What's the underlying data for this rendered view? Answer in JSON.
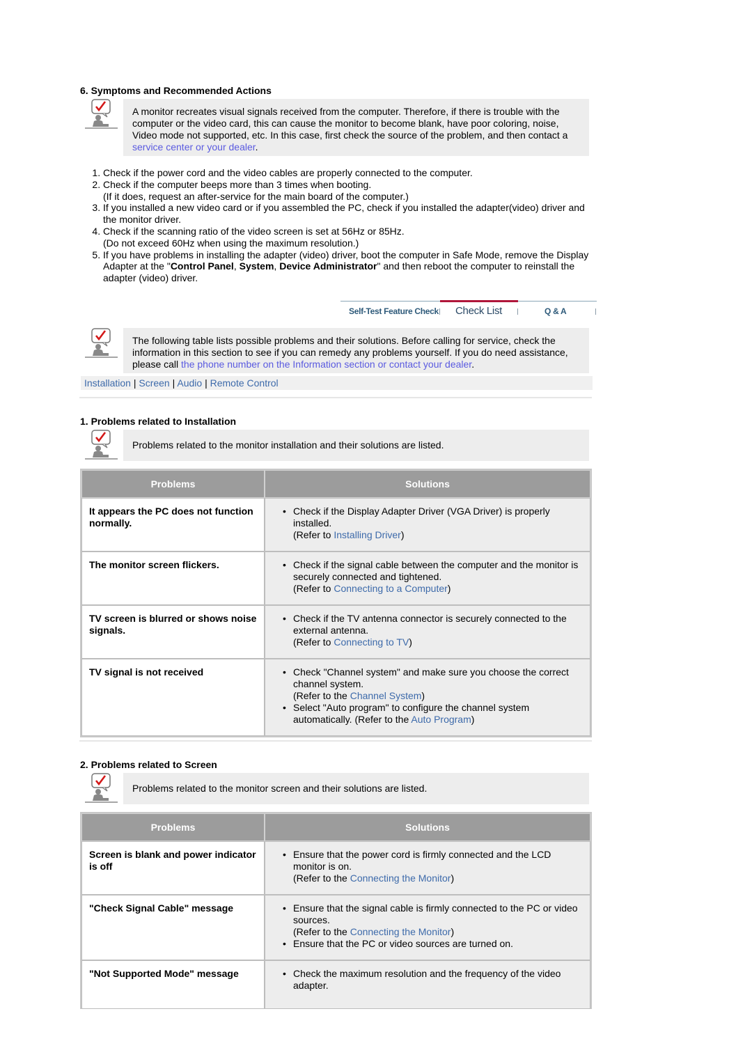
{
  "section6": {
    "title": "6. Symptoms and Recommended Actions",
    "intro_text": "A monitor recreates visual signals received from the computer. Therefore, if there is trouble with the computer or the video card, this can cause the monitor to become blank, have poor coloring, noise, Video mode not supported, etc. In this case, first check the source of the problem, and then contact a ",
    "intro_link": "service center or your dealer",
    "intro_end": ".",
    "steps": [
      {
        "text": "Check if the power cord and the video cables are properly connected to the computer."
      },
      {
        "text": "Check if the computer beeps more than 3 times when booting.",
        "sub": "(If it does, request an after-service for the main board of the computer.)"
      },
      {
        "text": "If you installed a new video card or if you assembled the PC, check if you installed the adapter(video) driver and the monitor driver."
      },
      {
        "text": "Check if the scanning ratio of the video screen is set at 56Hz or 85Hz.",
        "sub": "(Do not exceed 60Hz when using the maximum resolution.)"
      },
      {
        "pre": "If you have problems in installing the adapter (video) driver, boot the computer in Safe Mode, remove the Display Adapter at the \"",
        "b1": "Control Panel",
        "c1": ", ",
        "b2": "System",
        "c2": ", ",
        "b3": "Device Administrator",
        "post": "\" and then reboot the computer to reinstall the adapter (video) driver."
      }
    ]
  },
  "tabs": [
    {
      "label": "Self-Test Feature Check",
      "active": false
    },
    {
      "label": "Check List",
      "active": true
    },
    {
      "label": "Q & A",
      "active": false
    }
  ],
  "checklist_intro": {
    "text": "The following table lists possible problems and their solutions. Before calling for service, check the information in this section to see if you can remedy any problems yourself. If you do need assistance, please call ",
    "link": "the phone number on the Information section or contact your dealer",
    "end": "."
  },
  "nav_links": [
    "Installation",
    "Screen",
    "Audio",
    "Remote Control"
  ],
  "nav_sep": "|",
  "headers": {
    "problems": "Problems",
    "solutions": "Solutions"
  },
  "installation": {
    "title": "1. Problems related to Installation",
    "note": "Problems related to the monitor installation and their solutions are listed.",
    "rows": [
      {
        "problem": "It appears the PC does not function normally.",
        "solutions": [
          {
            "text": "Check if the Display Adapter Driver (VGA Driver) is properly installed.",
            "ref_pre": "(Refer to ",
            "ref_link": "Installing Driver",
            "ref_post": ")"
          }
        ]
      },
      {
        "problem": "The monitor screen flickers.",
        "solutions": [
          {
            "text": "Check if the signal cable between the computer and the monitor is securely connected and tightened.",
            "ref_pre": "(Refer to ",
            "ref_link": "Connecting to a Computer",
            "ref_post": ")"
          }
        ]
      },
      {
        "problem": "TV screen is blurred or shows noise signals.",
        "solutions": [
          {
            "text": "Check if the TV antenna connector is securely connected to the external antenna.",
            "ref_pre": "(Refer to ",
            "ref_link": "Connecting to TV",
            "ref_post": ")"
          }
        ]
      },
      {
        "problem": "TV signal is not received",
        "solutions": [
          {
            "text": "Check \"Channel system\" and make sure you choose the correct channel system.",
            "ref_pre": "(Refer to the ",
            "ref_link": "Channel System",
            "ref_post": ")"
          },
          {
            "text": "Select \"Auto program\" to configure the channel system automatically. (Refer to the ",
            "inline_link": "Auto Program",
            "inline_post": ")"
          }
        ]
      }
    ]
  },
  "screen": {
    "title": "2. Problems related to Screen",
    "note": "Problems related to the monitor screen and their solutions are listed.",
    "rows": [
      {
        "problem": "Screen is blank and power indicator is off",
        "solutions": [
          {
            "text": "Ensure that the power cord is firmly connected and the LCD monitor is on.",
            "ref_pre": "(Refer to the ",
            "ref_link": "Connecting the Monitor",
            "ref_post": ")"
          }
        ]
      },
      {
        "problem": "\"Check Signal Cable\" message",
        "solutions": [
          {
            "text": "Ensure that the signal cable is firmly connected to the PC or video sources.",
            "ref_pre": "(Refer to the ",
            "ref_link": "Connecting the Monitor",
            "ref_post": ")"
          },
          {
            "text": "Ensure that the PC or video sources are turned on."
          }
        ]
      },
      {
        "problem": "\"Not Supported Mode\" message",
        "solutions": [
          {
            "text": "Check the maximum resolution and the frequency of the video adapter."
          }
        ]
      }
    ]
  },
  "bullet": "•"
}
